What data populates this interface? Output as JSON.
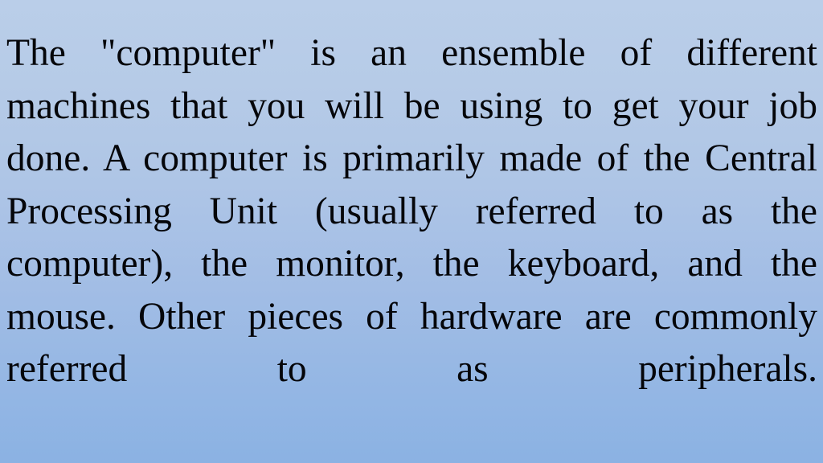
{
  "slide": {
    "background": {
      "gradient_top_color": "#bacee9",
      "gradient_bottom_color": "#8bb2e3",
      "direction": "vertical"
    },
    "text_color": "#05060a",
    "body_paragraph": "The \"computer\" is an ensemble of different machines that you will be using to get your job done. A computer is primarily made of the Central Processing Unit (usually referred to as the computer), the monitor, the keyboard, and the mouse. Other pieces of hardware are commonly referred to as peripherals.",
    "lines": [
      "The \"computer\" is an ensemble of different",
      "machines that you will be using to get your job",
      "done. A computer is primarily made of the",
      "Central Processing Unit (usually referred to as",
      "the computer), the monitor, the keyboard, and",
      "the mouse. Other pieces of hardware are",
      "commonly referred to as peripherals."
    ],
    "alignment": "justify"
  }
}
